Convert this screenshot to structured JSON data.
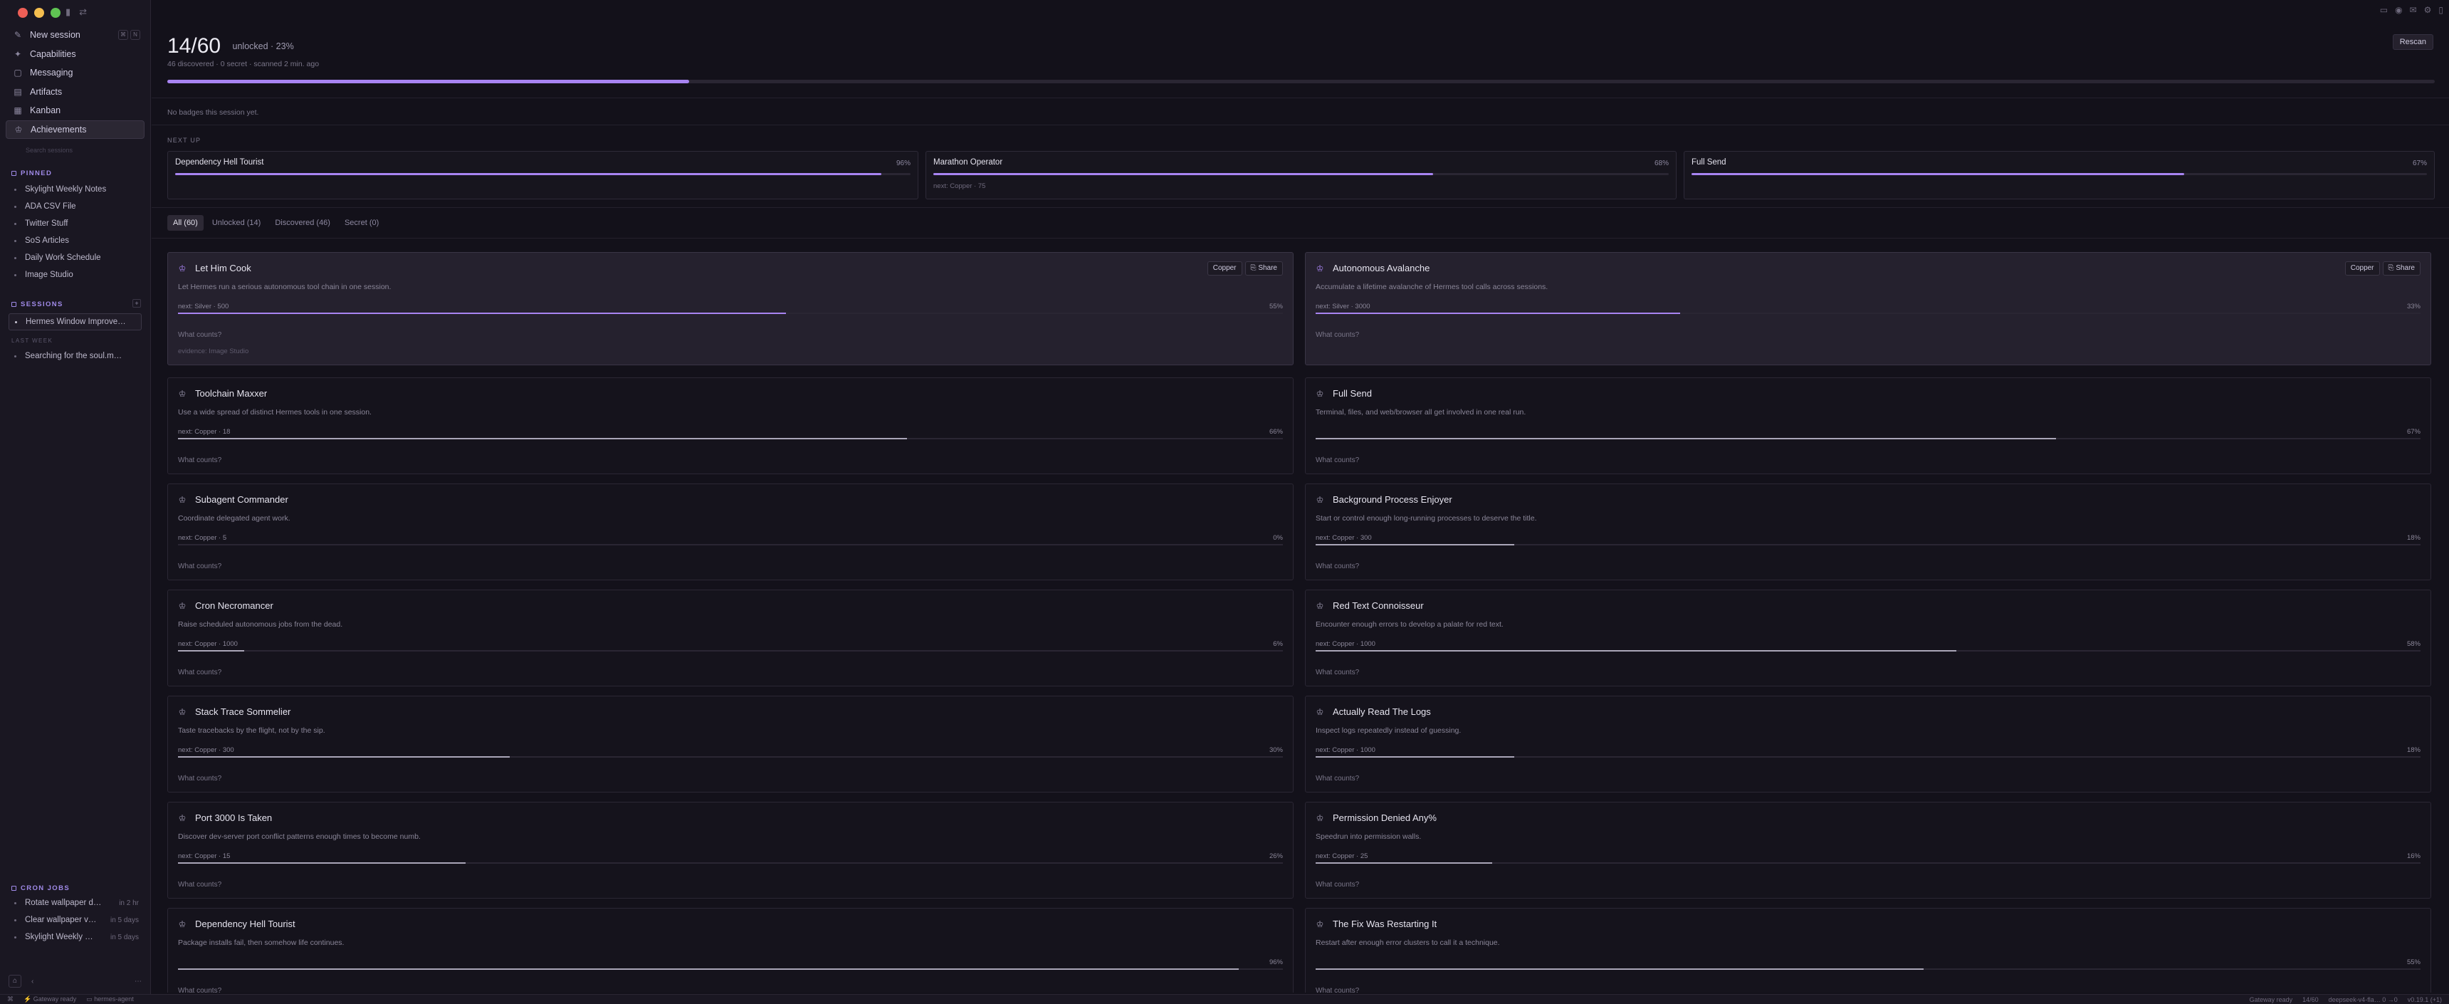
{
  "sidebar": {
    "nav": [
      {
        "label": "New session",
        "icon": "pencil-icon"
      },
      {
        "label": "Capabilities",
        "icon": "sparkle-icon"
      },
      {
        "label": "Messaging",
        "icon": "chat-icon"
      },
      {
        "label": "Artifacts",
        "icon": "file-icon"
      },
      {
        "label": "Kanban",
        "icon": "board-icon"
      },
      {
        "label": "Achievements",
        "icon": "trophy-icon"
      }
    ],
    "search_placeholder": "Search sessions",
    "pinned_label": "PINNED",
    "pinned": [
      "Skylight Weekly Notes",
      "ADA CSV File",
      "Twitter Stuff",
      "SoS Articles",
      "Daily Work Schedule",
      "Image Studio"
    ],
    "sessions_label": "SESSIONS",
    "sessions_active": "Hermes Window Improve…",
    "last_week_label": "LAST WEEK",
    "last_week": [
      "Searching for the soul.m…"
    ],
    "cron_label": "CRON JOBS",
    "cron": [
      {
        "label": "Rotate wallpaper d…",
        "when": "in 2 hr"
      },
      {
        "label": "Clear wallpaper v…",
        "when": "in 5 days"
      },
      {
        "label": "Skylight Weekly …",
        "when": "in 5 days"
      }
    ]
  },
  "status": {
    "left": [
      "Gateway ready",
      "hermes-agent"
    ],
    "right": [
      "Gateway ready",
      "14/60",
      "deepseek-v4-fla…  0 →0",
      "v0.19.1 (+1)"
    ]
  },
  "header": {
    "count": "14/60",
    "unlocked_text": "unlocked · 23%",
    "stats": "46 discovered · 0 secret · scanned 2 min. ago",
    "progress": 0.23,
    "rescan_label": "Rescan"
  },
  "no_badges": "No badges this session yet.",
  "next_up": {
    "label": "NEXT UP",
    "items": [
      {
        "title": "Dependency Hell Tourist",
        "pct": "96%",
        "progress": 0.96,
        "next": ""
      },
      {
        "title": "Marathon Operator",
        "pct": "68%",
        "progress": 0.68,
        "next": "next: Copper · 75"
      },
      {
        "title": "Full Send",
        "pct": "67%",
        "progress": 0.67,
        "next": ""
      }
    ]
  },
  "tabs": [
    "All (60)",
    "Unlocked (14)",
    "Discovered (46)",
    "Secret (0)"
  ],
  "what_counts": "What counts?",
  "actions": {
    "copper": "Copper",
    "share": "Share"
  },
  "cards": [
    {
      "title": "Let Him Cook",
      "desc": "Let Hermes run a serious autonomous tool chain in one session.",
      "next": "next: Silver · 500",
      "pct": "55%",
      "progress": 0.55,
      "unlocked": true,
      "evidence": "evidence: Image Studio"
    },
    {
      "title": "Autonomous Avalanche",
      "desc": "Accumulate a lifetime avalanche of Hermes tool calls across sessions.",
      "next": "next: Silver · 3000",
      "pct": "33%",
      "progress": 0.33,
      "unlocked": true,
      "evidence": ""
    },
    {
      "title": "Toolchain Maxxer",
      "desc": "Use a wide spread of distinct Hermes tools in one session.",
      "next": "next: Copper · 18",
      "pct": "66%",
      "progress": 0.66,
      "unlocked": false
    },
    {
      "title": "Full Send",
      "desc": "Terminal, files, and web/browser all get involved in one real run.",
      "next": "",
      "pct": "67%",
      "progress": 0.67,
      "unlocked": false
    },
    {
      "title": "Subagent Commander",
      "desc": "Coordinate delegated agent work.",
      "next": "next: Copper · 5",
      "pct": "0%",
      "progress": 0.0,
      "unlocked": false
    },
    {
      "title": "Background Process Enjoyer",
      "desc": "Start or control enough long-running processes to deserve the title.",
      "next": "next: Copper · 300",
      "pct": "18%",
      "progress": 0.18,
      "unlocked": false
    },
    {
      "title": "Cron Necromancer",
      "desc": "Raise scheduled autonomous jobs from the dead.",
      "next": "next: Copper · 1000",
      "pct": "6%",
      "progress": 0.06,
      "unlocked": false
    },
    {
      "title": "Red Text Connoisseur",
      "desc": "Encounter enough errors to develop a palate for red text.",
      "next": "next: Copper · 1000",
      "pct": "58%",
      "progress": 0.58,
      "unlocked": false
    },
    {
      "title": "Stack Trace Sommelier",
      "desc": "Taste tracebacks by the flight, not by the sip.",
      "next": "next: Copper · 300",
      "pct": "30%",
      "progress": 0.3,
      "unlocked": false
    },
    {
      "title": "Actually Read The Logs",
      "desc": "Inspect logs repeatedly instead of guessing.",
      "next": "next: Copper · 1000",
      "pct": "18%",
      "progress": 0.18,
      "unlocked": false
    },
    {
      "title": "Port 3000 Is Taken",
      "desc": "Discover dev-server port conflict patterns enough times to become numb.",
      "next": "next: Copper · 15",
      "pct": "26%",
      "progress": 0.26,
      "unlocked": false
    },
    {
      "title": "Permission Denied Any%",
      "desc": "Speedrun into permission walls.",
      "next": "next: Copper · 25",
      "pct": "16%",
      "progress": 0.16,
      "unlocked": false
    },
    {
      "title": "Dependency Hell Tourist",
      "desc": "Package installs fail, then somehow life continues.",
      "next": "",
      "pct": "96%",
      "progress": 0.96,
      "unlocked": false
    },
    {
      "title": "The Fix Was Restarting It",
      "desc": "Restart after enough error clusters to call it a technique.",
      "next": "",
      "pct": "55%",
      "progress": 0.55,
      "unlocked": false
    }
  ]
}
